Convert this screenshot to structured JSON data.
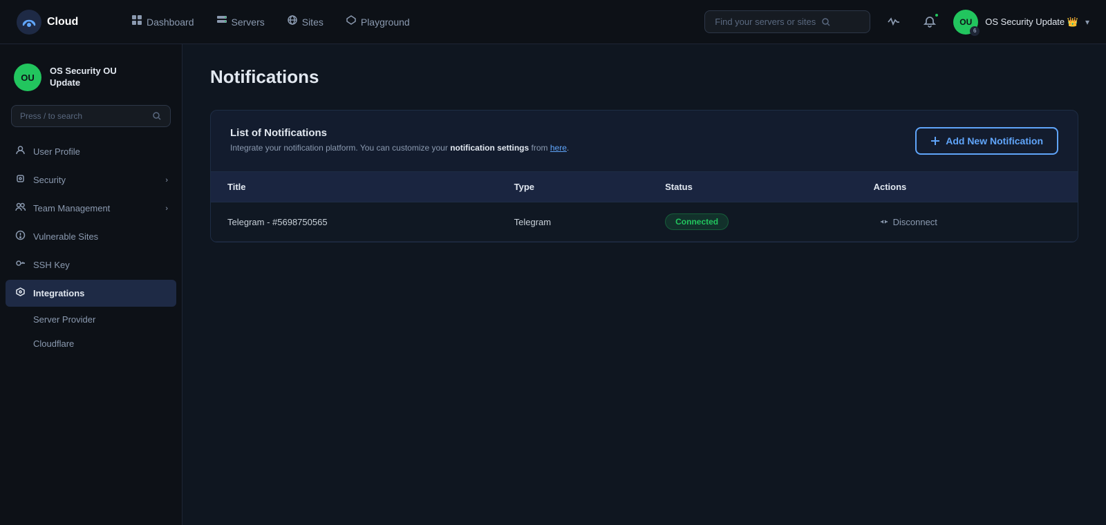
{
  "app": {
    "name": "Cloud",
    "logo_text": "Cloud"
  },
  "topnav": {
    "links": [
      {
        "id": "dashboard",
        "label": "Dashboard",
        "icon": "⊞"
      },
      {
        "id": "servers",
        "label": "Servers",
        "icon": "▦"
      },
      {
        "id": "sites",
        "label": "Sites",
        "icon": "🌐"
      },
      {
        "id": "playground",
        "label": "Playground",
        "icon": "⬡"
      }
    ],
    "search_placeholder": "Find your servers or sites",
    "user": {
      "initials": "OU",
      "badge": "6",
      "name": "OS Security Update",
      "crown": "👑"
    }
  },
  "sidebar": {
    "workspace": {
      "initials": "OU",
      "name_line1": "OS Security OU",
      "name_line2": "Update"
    },
    "search_placeholder": "Press / to search",
    "items": [
      {
        "id": "user-profile",
        "label": "User Profile",
        "icon": "👤",
        "has_caret": false
      },
      {
        "id": "security",
        "label": "Security",
        "icon": "⚙",
        "has_caret": true
      },
      {
        "id": "team-management",
        "label": "Team Management",
        "icon": "👥",
        "has_caret": true
      },
      {
        "id": "vulnerable-sites",
        "label": "Vulnerable Sites",
        "icon": "⚠",
        "has_caret": false
      },
      {
        "id": "ssh-key",
        "label": "SSH Key",
        "icon": "🔑",
        "has_caret": false
      },
      {
        "id": "integrations",
        "label": "Integrations",
        "icon": "⚙",
        "has_caret": false,
        "active": true
      }
    ],
    "subitems": [
      {
        "id": "server-provider",
        "label": "Server Provider"
      },
      {
        "id": "cloudflare",
        "label": "Cloudflare"
      }
    ]
  },
  "page": {
    "title": "Notifications"
  },
  "notifications": {
    "card": {
      "title": "List of Notifications",
      "description_prefix": "Integrate your notification platform. You can customize your ",
      "description_bold": "notification settings",
      "description_suffix": " from ",
      "description_link": "here",
      "description_end": "."
    },
    "add_button_label": "Add New Notification",
    "table": {
      "columns": [
        "Title",
        "Type",
        "Status",
        "Actions"
      ],
      "rows": [
        {
          "title": "Telegram - #5698750565",
          "type": "Telegram",
          "status": "Connected",
          "action": "Disconnect"
        }
      ]
    }
  }
}
